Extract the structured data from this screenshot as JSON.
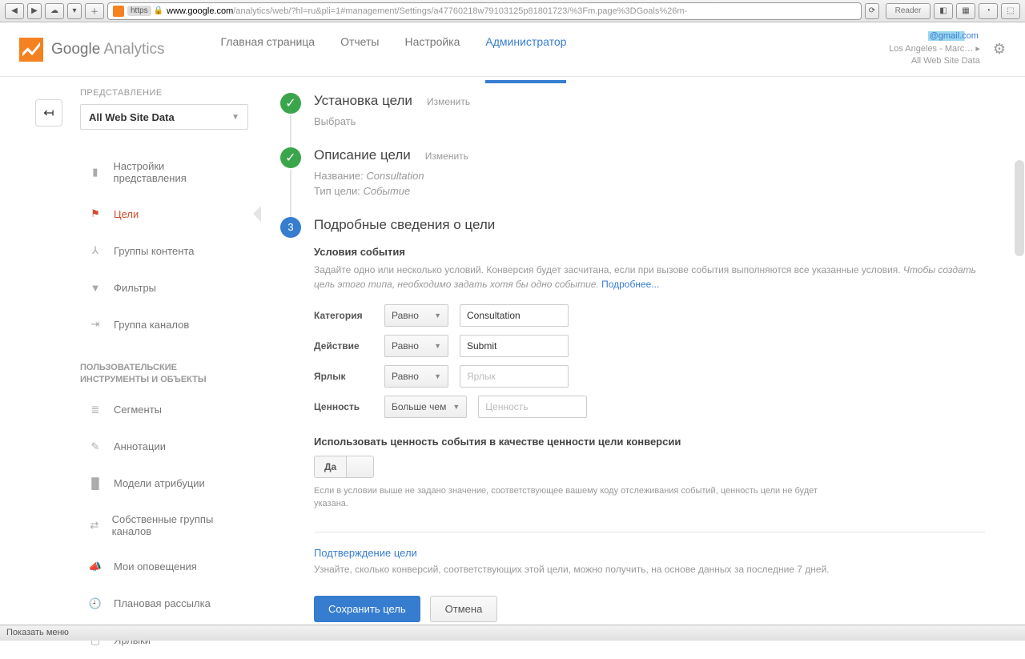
{
  "browser": {
    "url_domain": "www.google.com",
    "url_path": "/analytics/web/?hl=ru&pli=1#management/Settings/a47760218w79103125p81801723/%3Fm.page%3DGoals%26m-",
    "reader": "Reader",
    "https": "https"
  },
  "header": {
    "logo_google": "Google",
    "logo_analytics": " Analytics",
    "nav": [
      "Главная страница",
      "Отчеты",
      "Настройка",
      "Администратор"
    ],
    "active_nav": 3,
    "email": "@gmail.com",
    "account_line": "Los Angeles - Marc…  ▸",
    "view_line": "All Web Site Data",
    "gear": "⚙"
  },
  "sidebar": {
    "section": "ПРЕДСТАВЛЕНИЕ",
    "view": "All Web Site Data",
    "items": [
      {
        "label": "Настройки представления"
      },
      {
        "label": "Цели"
      },
      {
        "label": "Группы контента"
      },
      {
        "label": "Фильтры"
      },
      {
        "label": "Группа каналов"
      }
    ],
    "section2": "ПОЛЬЗОВАТЕЛЬСКИЕ ИНСТРУМЕНТЫ И ОБЪЕКТЫ",
    "items2": [
      {
        "label": "Сегменты"
      },
      {
        "label": "Аннотации"
      },
      {
        "label": "Модели атрибуции"
      },
      {
        "label": "Собственные группы каналов"
      },
      {
        "label": "Мои оповещения"
      },
      {
        "label": "Плановая рассылка"
      },
      {
        "label": "Ярлыки"
      }
    ]
  },
  "steps": {
    "s1_title": "Установка цели",
    "s1_edit": "Изменить",
    "s1_sub": "Выбрать",
    "s2_title": "Описание цели",
    "s2_edit": "Изменить",
    "s2_name_label": "Название: ",
    "s2_name_value": "Consultation",
    "s2_type_label": "Тип цели: ",
    "s2_type_value": "Событие",
    "s3_num": "3",
    "s3_title": "Подробные сведения о цели"
  },
  "conditions": {
    "title": "Условия события",
    "desc1": "Задайте одно или несколько условий. Конверсия будет засчитана, если при вызове события выполняются все указанные условия. ",
    "desc2": "Чтобы создать цель этого типа, необходимо задать хотя бы одно событие. ",
    "more": "Подробнее...",
    "rows": [
      {
        "label": "Категория",
        "op": "Равно",
        "value": "Consultation",
        "ph": ""
      },
      {
        "label": "Действие",
        "op": "Равно",
        "value": "Submit",
        "ph": ""
      },
      {
        "label": "Ярлык",
        "op": "Равно",
        "value": "",
        "ph": "Ярлык"
      },
      {
        "label": "Ценность",
        "op": "Больше чем",
        "value": "",
        "ph": "Ценность"
      }
    ]
  },
  "value_section": {
    "question": "Использовать ценность события в качестве ценности цели конверсии",
    "yes": "Да",
    "note": "Если в условии выше не задано значение, соответствующее вашему коду отслеживания событий, ценность цели не будет указана."
  },
  "confirm": {
    "link": "Подтверждение цели",
    "note": "Узнайте, сколько конверсий, соответствующих этой цели, можно получить, на основе данных за последние 7 дней."
  },
  "buttons": {
    "save": "Сохранить цель",
    "cancel": "Отмена"
  },
  "status": "Показать меню"
}
